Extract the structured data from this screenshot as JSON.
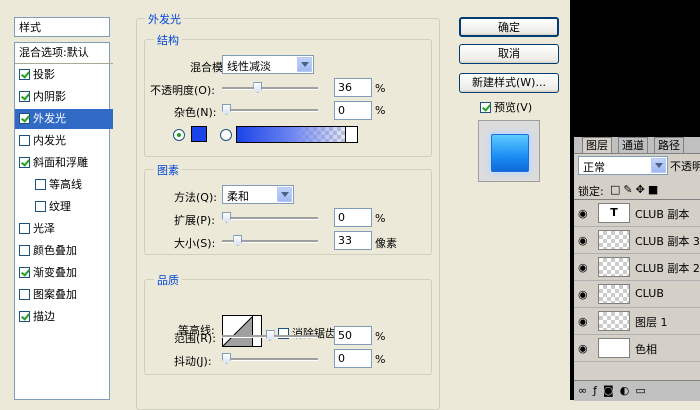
{
  "styles_panel": {
    "header": "样式",
    "items": [
      {
        "label": "混合选项:默认",
        "checkbox": false,
        "checked": false,
        "indent": false,
        "selected": false
      },
      {
        "label": "投影",
        "checkbox": true,
        "checked": true,
        "indent": false,
        "selected": false
      },
      {
        "label": "内阴影",
        "checkbox": true,
        "checked": true,
        "indent": false,
        "selected": false
      },
      {
        "label": "外发光",
        "checkbox": true,
        "checked": true,
        "indent": false,
        "selected": true
      },
      {
        "label": "内发光",
        "checkbox": true,
        "checked": false,
        "indent": false,
        "selected": false
      },
      {
        "label": "斜面和浮雕",
        "checkbox": true,
        "checked": true,
        "indent": false,
        "selected": false
      },
      {
        "label": "等高线",
        "checkbox": true,
        "checked": false,
        "indent": true,
        "selected": false
      },
      {
        "label": "纹理",
        "checkbox": true,
        "checked": false,
        "indent": true,
        "selected": false
      },
      {
        "label": "光泽",
        "checkbox": true,
        "checked": false,
        "indent": false,
        "selected": false
      },
      {
        "label": "颜色叠加",
        "checkbox": true,
        "checked": false,
        "indent": false,
        "selected": false
      },
      {
        "label": "渐变叠加",
        "checkbox": true,
        "checked": true,
        "indent": false,
        "selected": false
      },
      {
        "label": "图案叠加",
        "checkbox": true,
        "checked": false,
        "indent": false,
        "selected": false
      },
      {
        "label": "描边",
        "checkbox": true,
        "checked": true,
        "indent": false,
        "selected": false
      }
    ]
  },
  "outer_glow": {
    "title": "外发光",
    "structure": {
      "title": "结构",
      "blend_mode_label": "混合模式:",
      "blend_mode_value": "线性减淡",
      "opacity_label": "不透明度(O):",
      "opacity_value": "36",
      "opacity_fraction": 0.36,
      "noise_label": "杂色(N):",
      "noise_value": "0",
      "noise_fraction": 0,
      "percent": "%",
      "color_hex": "#1a44e8"
    },
    "elements": {
      "title": "图素",
      "method_label": "方法(Q):",
      "method_value": "柔和",
      "spread_label": "扩展(P):",
      "spread_value": "0",
      "spread_fraction": 0,
      "size_label": "大小(S):",
      "size_value": "33",
      "size_fraction": 0.13,
      "pixels": "像素",
      "percent": "%"
    },
    "quality": {
      "title": "品质",
      "contour_label": "等高线:",
      "antialias_label": "消除锯齿(L)",
      "antialias_checked": false,
      "range_label": "范围(R):",
      "range_value": "50",
      "range_fraction": 0.5,
      "jitter_label": "抖动(J):",
      "jitter_value": "0",
      "jitter_fraction": 0,
      "percent": "%"
    }
  },
  "buttons": {
    "ok": "确定",
    "cancel": "取消",
    "new_style": "新建样式(W)...",
    "preview_label": "预览(V)",
    "preview_checked": true
  },
  "layers_panel": {
    "tabs": [
      "图层",
      "通道",
      "路径"
    ],
    "blend_mode": "正常",
    "opacity_label": "不透明",
    "lock_label": "锁定:",
    "layers": [
      {
        "name": "CLUB 副本",
        "type": "text",
        "selected": false
      },
      {
        "name": "CLUB 副本 3",
        "type": "pixel",
        "selected": false
      },
      {
        "name": "CLUB 副本 2",
        "type": "pixel",
        "selected": false
      },
      {
        "name": "CLUB",
        "type": "pixel",
        "selected": false
      },
      {
        "name": "图层 1",
        "type": "pixel",
        "selected": false
      },
      {
        "name": "色相",
        "type": "adjustment",
        "selected": false
      }
    ]
  }
}
